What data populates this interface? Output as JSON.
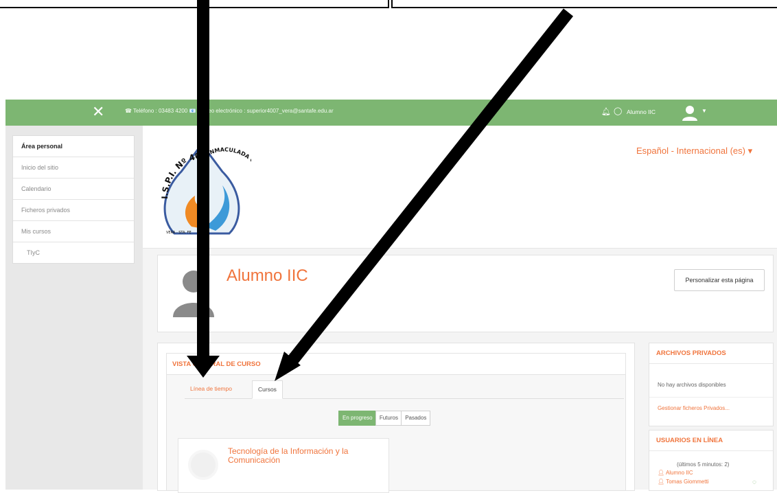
{
  "header": {
    "contact_info": "☎ Teléfono : 03483 4200 📧 Correo electrónico : superior4007_vera@santafe.edu.ar",
    "user_name": "Alumno IIC"
  },
  "colors": {
    "accent_green": "#7db672",
    "brand_orange": "#f0743c"
  },
  "sidebar": {
    "items": [
      {
        "label": "Área personal"
      },
      {
        "label": "Inicio del sitio"
      },
      {
        "label": "Calendario"
      },
      {
        "label": "Ficheros privados"
      },
      {
        "label": "Mis cursos"
      },
      {
        "label": "TIyC"
      }
    ]
  },
  "logo": {
    "top_text": "I.S.P.I. Nº 4007",
    "right_text": "INMACULADA CONCEPCIÓN",
    "bottom_text": "VERA - STA. FE"
  },
  "language": {
    "selected": "Español - Internacional (es) ▾"
  },
  "profile": {
    "name": "Alumno IIC",
    "customize_button": "Personalizar esta página"
  },
  "overview": {
    "title": "VISTA GENERAL DE CURSO",
    "tabs": [
      {
        "label": "Línea de tiempo"
      },
      {
        "label": "Cursos"
      }
    ],
    "filters": [
      {
        "label": "En progreso"
      },
      {
        "label": "Futuros"
      },
      {
        "label": "Pasados"
      }
    ],
    "course": {
      "title": "Tecnología de la Información y la Comunicación"
    }
  },
  "private_files": {
    "title": "ARCHIVOS PRIVADOS",
    "empty_text": "No hay archivos disponibles",
    "manage_link": "Gestionar ficheros Privados..."
  },
  "online_users": {
    "title": "USUARIOS EN LÍNEA",
    "meta": "(últimos 5 minutos: 2)",
    "users": [
      {
        "name": "Alumno IIC"
      },
      {
        "name": "Tomas Giommetti"
      }
    ]
  }
}
